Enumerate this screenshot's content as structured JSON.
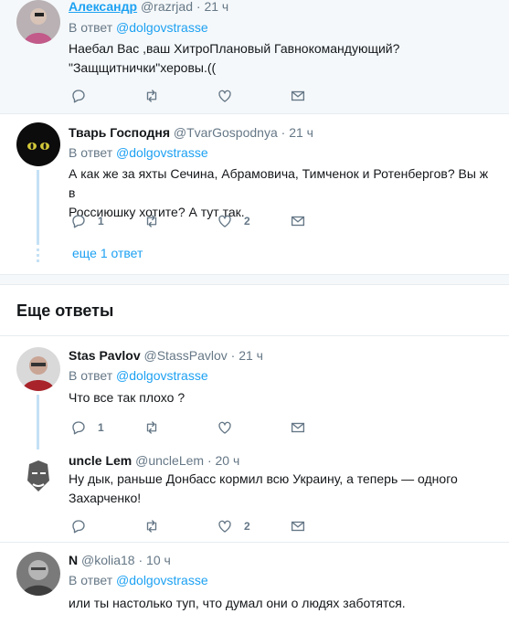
{
  "replies": [
    {
      "name": "Александр",
      "handle": "@razrjad",
      "dot": "·",
      "time": "21 ч",
      "reply_prefix": "В ответ",
      "reply_to": "@dolgovstrasse",
      "text_lines": [
        "Наебал Вас ,ваш ХитроПлановый Гавнокомандующий?",
        "\"Защщитнички\"херовы.(("
      ],
      "reply_count": "",
      "like_count": ""
    },
    {
      "name": "Тварь Господня",
      "handle": "@TvarGospodnya",
      "dot": "·",
      "time": "21 ч",
      "reply_prefix": "В ответ",
      "reply_to": "@dolgovstrasse",
      "text_lines": [
        "А как же за яхты Сечина, Абрамовича, Тимченок и Ротенбергов? Вы ж в",
        "Россиюшку хотите?  А тут так."
      ],
      "reply_count": "1",
      "like_count": "2"
    }
  ],
  "more_replies_link": "еще 1 ответ",
  "section_title": "Еще ответы",
  "more": [
    {
      "name": "Stas Pavlov",
      "handle": "@StassPavlov",
      "dot": "·",
      "time": "21 ч",
      "reply_prefix": "В ответ",
      "reply_to": "@dolgovstrasse",
      "text_lines": [
        "Что все так плохо ?"
      ],
      "reply_count": "1",
      "like_count": ""
    },
    {
      "name": "uncle Lem",
      "handle": "@uncleLem",
      "dot": "·",
      "time": "20 ч",
      "text_lines": [
        "Ну дык, раньше Донбасс кормил всю Украину, а теперь — одного",
        "Захарченко!"
      ],
      "reply_count": "",
      "like_count": "2"
    },
    {
      "name": "N",
      "handle": "@kolia18",
      "dot": "·",
      "time": "10 ч",
      "reply_prefix": "В ответ",
      "reply_to": "@dolgovstrasse",
      "text_lines": [
        "или ты настолько туп, что думал они о людях заботятся."
      ]
    }
  ],
  "icons": {
    "reply": "reply-icon",
    "retweet": "retweet-icon",
    "like": "heart-icon",
    "dm": "envelope-icon"
  },
  "colors": {
    "accent": "#1da1f2",
    "muted": "#657786",
    "thread": "#c4e1f5",
    "highlight_bg": "#f5f8fa"
  }
}
